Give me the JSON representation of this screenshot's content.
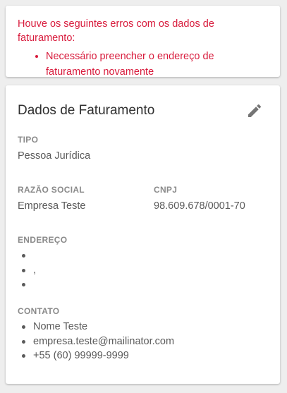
{
  "error": {
    "title": "Houve os seguintes erros com os dados de faturamento:",
    "items": [
      "Necessário preencher o endereço de faturamento novamente"
    ]
  },
  "billing": {
    "title": "Dados de Faturamento",
    "edit_icon": "pencil-icon",
    "tipo": {
      "label": "TIPO",
      "value": "Pessoa Jurídica"
    },
    "razao_social": {
      "label": "RAZÃO SOCIAL",
      "value": "Empresa Teste"
    },
    "cnpj": {
      "label": "CNPJ",
      "value": "98.609.678/0001-70"
    },
    "endereco": {
      "label": "ENDEREÇO",
      "lines": [
        "",
        ",",
        ""
      ]
    },
    "contato": {
      "label": "CONTATO",
      "lines": [
        "Nome Teste",
        "empresa.teste@mailinator.com",
        "+55 (60) 99999-9999"
      ]
    }
  },
  "colors": {
    "error": "#d81b3c",
    "label": "#8a8a8a",
    "text": "#5a5a5a",
    "title": "#2f2f2f",
    "background": "#eeeeee",
    "card": "#ffffff"
  }
}
